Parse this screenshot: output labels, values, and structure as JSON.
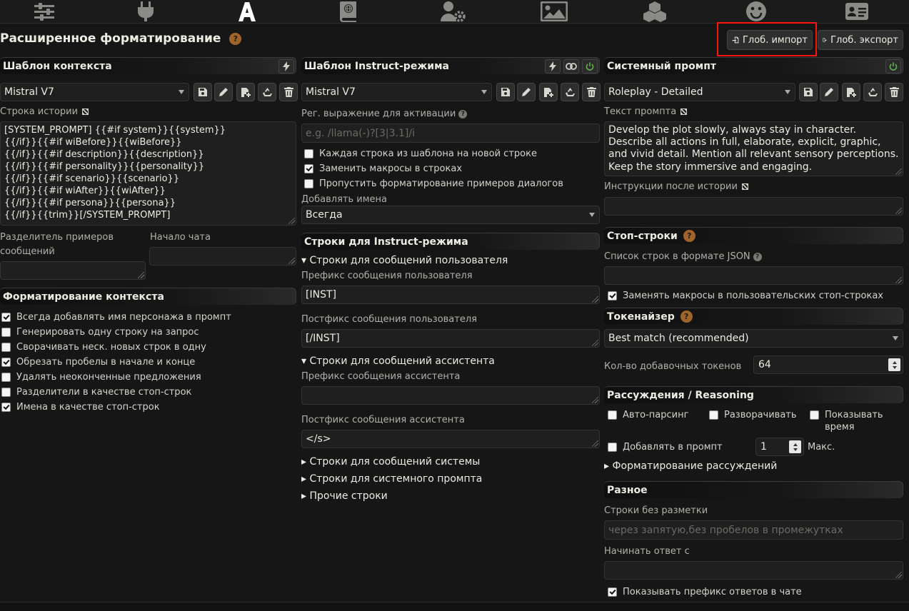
{
  "nav": {
    "icons": [
      "sliders-icon",
      "plug-icon",
      "font-a-icon",
      "book-globe-icon",
      "user-gear-icon",
      "image-icon",
      "cubes-icon",
      "smile-icon",
      "id-card-icon"
    ],
    "active": "font-a-icon"
  },
  "page": {
    "title": "Расширенное форматирование",
    "help": "?",
    "import_label": "Глоб. импорт",
    "export_label": "Глоб. экспорт"
  },
  "context": {
    "title": "Шаблон контекста",
    "preset": "Mistral V7",
    "story_label": "Строка истории",
    "story": "[SYSTEM_PROMPT] {{#if system}}{{system}}\n{{/if}}{{#if wiBefore}}{{wiBefore}}\n{{/if}}{{#if description}}{{description}}\n{{/if}}{{#if personality}}{{personality}}\n{{/if}}{{#if scenario}}{{scenario}}\n{{/if}}{{#if wiAfter}}{{wiAfter}}\n{{/if}}{{#if persona}}{{persona}}\n{{/if}}{{trim}}[/SYSTEM_PROMPT]",
    "separator_label_1": "Разделитель примеров",
    "separator_label_2": "сообщений",
    "chat_start_label": "Начало чата",
    "formatting_title": "Форматирование контекста",
    "checks": [
      {
        "label": "Всегда добавлять имя персонажа в промпт",
        "checked": true
      },
      {
        "label": "Генерировать одну строку на запрос",
        "checked": false
      },
      {
        "label": "Сворачивать неск. новых строк в одну",
        "checked": false
      },
      {
        "label": "Обрезать пробелы в начале и конце",
        "checked": true
      },
      {
        "label": "Удалять неоконченные предложения",
        "checked": false
      },
      {
        "label": "Разделители в качестве стоп-строк",
        "checked": false
      },
      {
        "label": "Имена в качестве стоп-строк",
        "checked": true
      }
    ]
  },
  "instruct": {
    "title": "Шаблон Instruct-режима",
    "preset": "Mistral V7",
    "regex_label": "Рег. выражение для активации",
    "regex_placeholder": "e.g. /llama(-)?[3|3.1]/i",
    "checks": [
      {
        "label": "Каждая строка из шаблона на новой строке",
        "checked": false
      },
      {
        "label": "Заменить макросы в строках",
        "checked": true
      },
      {
        "label": "Пропустить форматирование примеров диалогов",
        "checked": false
      }
    ],
    "names_label": "Добавлять имена",
    "names_value": "Всегда",
    "strings_title": "Строки для Instruct-режима",
    "user_group": "▾ Строки для сообщений пользователя",
    "user_prefix_label": "Префикс сообщения пользователя",
    "user_prefix": "[INST]",
    "user_suffix_label": "Постфикс сообщения пользователя",
    "user_suffix": "[/INST]",
    "assistant_group": "▾ Строки для сообщений ассистента",
    "assistant_prefix_label": "Префикс сообщения ассистента",
    "assistant_prefix": "",
    "assistant_suffix_label": "Постфикс сообщения ассистента",
    "assistant_suffix": "</s>",
    "system_group": "▸ Строки для сообщений системы",
    "sysprompt_group": "▸ Строки для системного промпта",
    "other_group": "▸ Прочие строки"
  },
  "sysprompt": {
    "title": "Системный промпт",
    "preset": "Roleplay - Detailed",
    "text_label": "Текст промпта",
    "text": "Develop the plot slowly, always stay in character. Describe all actions in full, elaborate, explicit, graphic, and vivid detail. Mention all relevant sensory perceptions. Keep the story immersive and engaging.",
    "post_history_label": "Инструкции после истории",
    "stop_title": "Стоп-строки",
    "stop_list_label": "Список строк в формате JSON",
    "stop_replace_label": "Заменять макросы в пользовательских стоп-строках",
    "stop_replace_checked": true,
    "tokenizer_title": "Токенайзер",
    "tokenizer_value": "Best match (recommended)",
    "extra_tokens_label": "Кол-во добавочных токенов",
    "extra_tokens": "64",
    "reasoning_title": "Рассуждения / Reasoning",
    "auto_parse": "Авто-парсинг",
    "expand": "Разворачивать",
    "show_time_1": "Показывать",
    "show_time_2": "время",
    "add_to_prompt": "Добавлять в промпт",
    "max_value": "1",
    "max_label": "Макс.",
    "reasoning_format": "▸ Форматирование рассуждений",
    "misc_title": "Разное",
    "nomarkup_label": "Строки без разметки",
    "nomarkup_placeholder": "через запятую,без пробелов в промежутках",
    "start_reply_label": "Начинать ответ с",
    "show_prefix_label": "Показывать префикс ответов в чате",
    "show_prefix_checked": true
  },
  "colors": {
    "accent_help": "#a0632a",
    "highlight": "#ff1212",
    "power_green": "#63b04a"
  }
}
